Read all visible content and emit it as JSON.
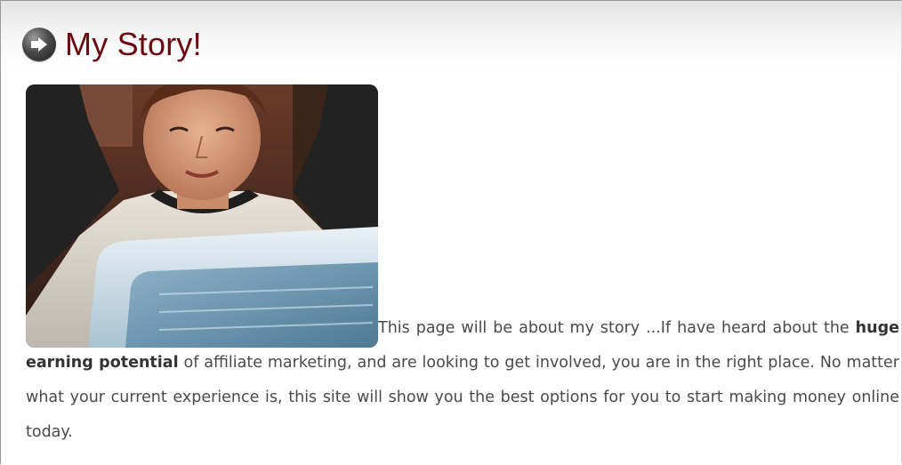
{
  "header": {
    "title": "My Story!",
    "bullet_icon": "arrow-right-circle-icon"
  },
  "story": {
    "image_description": "photo-man-at-computer",
    "text_part1": "This page will be about my story ...If have heard about the ",
    "emphasis": "huge earning potential",
    "text_part2": " of affiliate marketing, and are looking to get involved, you are in the right place. No matter what your current experience is, this site will show you the best options for you to start making money online today."
  },
  "colors": {
    "title": "#6b0b10",
    "body_text": "#4a4a4a",
    "emphasis_text": "#333333"
  }
}
